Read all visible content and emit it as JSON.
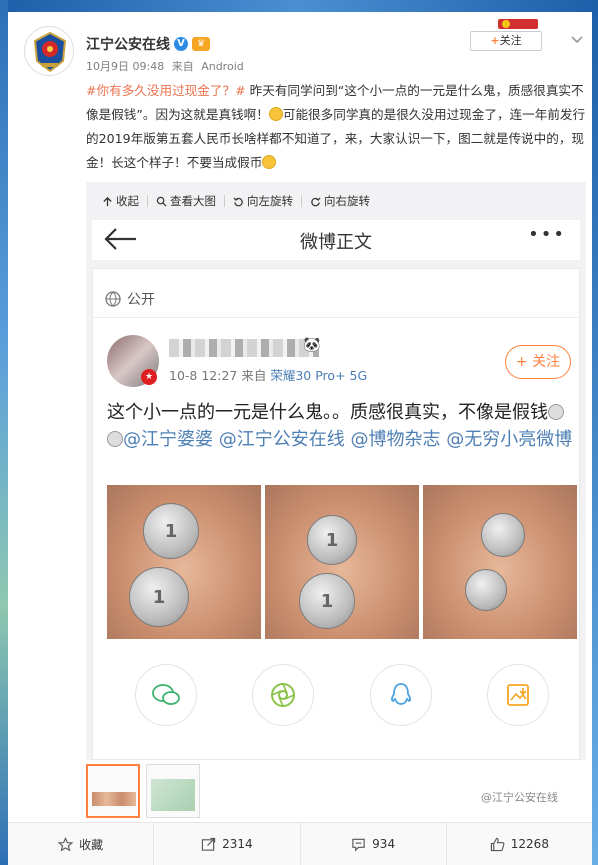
{
  "post": {
    "author": "江宁公安在线",
    "verified_mark": "V",
    "date": "10月9日 09:48",
    "source_prefix": "来自",
    "source": "Android",
    "follow_label": "关注",
    "topic": "#你有多久没用过现金了？#",
    "text_part1": " 昨天有同学问到“这个小一点的一元是什么鬼，质感很真实不像是假钱”。因为这就是真钱啊！",
    "text_part2": "可能很多同学真的是很久没用过现金了，连一年前发行的2019年版第五套人民币长啥样都不知道了，来，大家认识一下，图二就是传说中的，现金！长这个样子！不要当成假币"
  },
  "toolbar": {
    "collect": "收起",
    "view_large": "查看大图",
    "rotate_left": "向左旋转",
    "rotate_right": "向右旋转"
  },
  "screenshot": {
    "title": "微博正文",
    "visibility": "公开",
    "meta_time": "10-8 12:27",
    "meta_from": "来自",
    "meta_device": "荣耀30 Pro+ 5G",
    "follow": "关注",
    "text_main": "这个小一点的一元是什么鬼。。质感很真实，不像是假钱",
    "mentions": [
      "@江宁婆婆",
      "@江宁公安在线",
      "@博物杂志",
      "@无穷小亮微博"
    ],
    "coin_labels": [
      "1",
      "1",
      "1",
      "1"
    ],
    "watermark": "@江宁公安在线"
  },
  "footer": {
    "collect": "收藏",
    "repost": "2314",
    "comment": "934",
    "like": "12268"
  }
}
